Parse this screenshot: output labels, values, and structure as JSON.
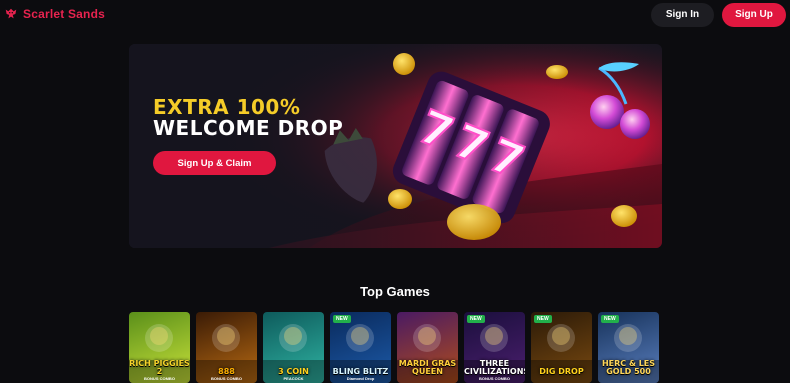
{
  "header": {
    "brand_name": "Scarlet Sands",
    "sign_in_label": "Sign In",
    "sign_up_label": "Sign Up"
  },
  "hero": {
    "line1": "EXTRA 100%",
    "line2": "WELCOME DROP",
    "cta_label": "Sign Up & Claim"
  },
  "section": {
    "title": "Top Games"
  },
  "games": [
    {
      "title": "RICH PIGGIES 2",
      "subtitle": "BONUS COMBO",
      "badge": "",
      "colors": [
        "#5a8f1a",
        "#c9e23a"
      ],
      "title_color": "#f4d22a"
    },
    {
      "title": "888",
      "subtitle": "BONUS COMBO",
      "badge": "",
      "colors": [
        "#3a1b06",
        "#b86a12"
      ],
      "title_color": "#ffb000"
    },
    {
      "title": "3 COIN",
      "subtitle": "PEACOCK",
      "badge": "",
      "colors": [
        "#0e5b5c",
        "#2fb3a2"
      ],
      "title_color": "#ffd21c"
    },
    {
      "title": "BLING BLITZ",
      "subtitle": "Diamond Drop",
      "badge": "NEW",
      "colors": [
        "#0a2a5c",
        "#1c5aa8"
      ],
      "title_color": "#d7f4ff"
    },
    {
      "title": "MARDI GRAS QUEEN",
      "subtitle": "",
      "badge": "",
      "colors": [
        "#4a1a63",
        "#b14d1a"
      ],
      "title_color": "#ffcf3a"
    },
    {
      "title": "THREE CIVILIZATIONS",
      "subtitle": "BONUS COMBO",
      "badge": "NEW",
      "colors": [
        "#1b0f3d",
        "#4b1f6e"
      ],
      "title_color": "#ffffff"
    },
    {
      "title": "DIG DROP",
      "subtitle": "",
      "badge": "NEW",
      "colors": [
        "#2b1a08",
        "#7a4a10"
      ],
      "title_color": "#ffd21c"
    },
    {
      "title": "HERC & LES GOLD 500",
      "subtitle": "",
      "badge": "NEW",
      "colors": [
        "#17325a",
        "#5a7fbf"
      ],
      "title_color": "#ffd75a"
    }
  ]
}
